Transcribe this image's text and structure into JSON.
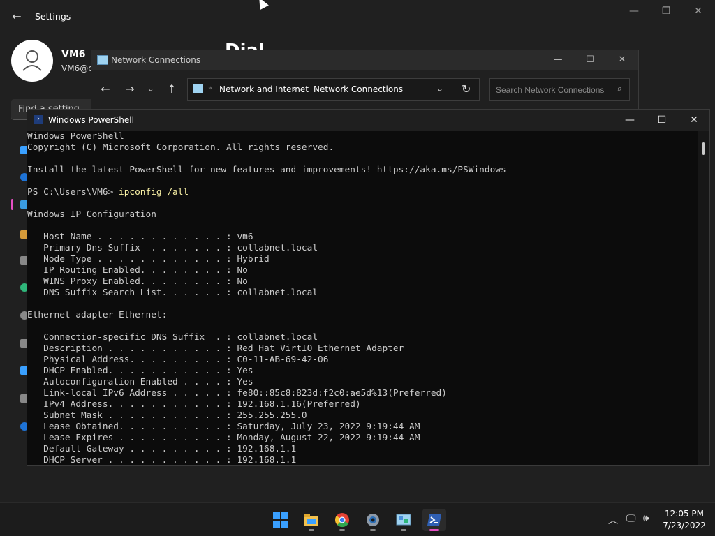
{
  "settings": {
    "title": "Settings",
    "user_name": "VM6",
    "user_email": "VM6@c",
    "page_heading": "Dial",
    "find_setting": "Find a setting"
  },
  "netconn": {
    "title": "Network Connections",
    "breadcrumb_1": "Network and Internet",
    "breadcrumb_2": "Network Connections",
    "search_placeholder": "Search Network Connections"
  },
  "powershell": {
    "title": "Windows PowerShell",
    "lines": [
      "Windows PowerShell",
      "Copyright (C) Microsoft Corporation. All rights reserved.",
      "",
      "Install the latest PowerShell for new features and improvements! https://aka.ms/PSWindows",
      "",
      "PS C:\\Users\\VM6> ",
      "",
      "Windows IP Configuration",
      "",
      "   Host Name . . . . . . . . . . . . : vm6",
      "   Primary Dns Suffix  . . . . . . . : collabnet.local",
      "   Node Type . . . . . . . . . . . . : Hybrid",
      "   IP Routing Enabled. . . . . . . . : No",
      "   WINS Proxy Enabled. . . . . . . . : No",
      "   DNS Suffix Search List. . . . . . : collabnet.local",
      "",
      "Ethernet adapter Ethernet:",
      "",
      "   Connection-specific DNS Suffix  . : collabnet.local",
      "   Description . . . . . . . . . . . : Red Hat VirtIO Ethernet Adapter",
      "   Physical Address. . . . . . . . . : C0-11-AB-69-42-06",
      "   DHCP Enabled. . . . . . . . . . . : Yes",
      "   Autoconfiguration Enabled . . . . : Yes",
      "   Link-local IPv6 Address . . . . . : fe80::85c8:823d:f2c0:ae5d%13(Preferred)",
      "   IPv4 Address. . . . . . . . . . . : 192.168.1.16(Preferred)",
      "   Subnet Mask . . . . . . . . . . . : 255.255.255.0",
      "   Lease Obtained. . . . . . . . . . : Saturday, July 23, 2022 9:19:44 AM",
      "   Lease Expires . . . . . . . . . . : Monday, August 22, 2022 9:19:44 AM",
      "   Default Gateway . . . . . . . . . : 192.168.1.1",
      "   DHCP Server . . . . . . . . . . . : 192.168.1.1"
    ],
    "command": "ipconfig /all"
  },
  "taskbar": {
    "time": "12:05 PM",
    "date": "7/23/2022",
    "apps": [
      "start",
      "file-explorer",
      "chrome",
      "settings",
      "control-panel",
      "powershell"
    ]
  },
  "colors": {
    "accent": "#e64fc4",
    "console_bg": "#0c0c0c",
    "console_text": "#cccccc",
    "command_text": "#f9f1a5"
  }
}
